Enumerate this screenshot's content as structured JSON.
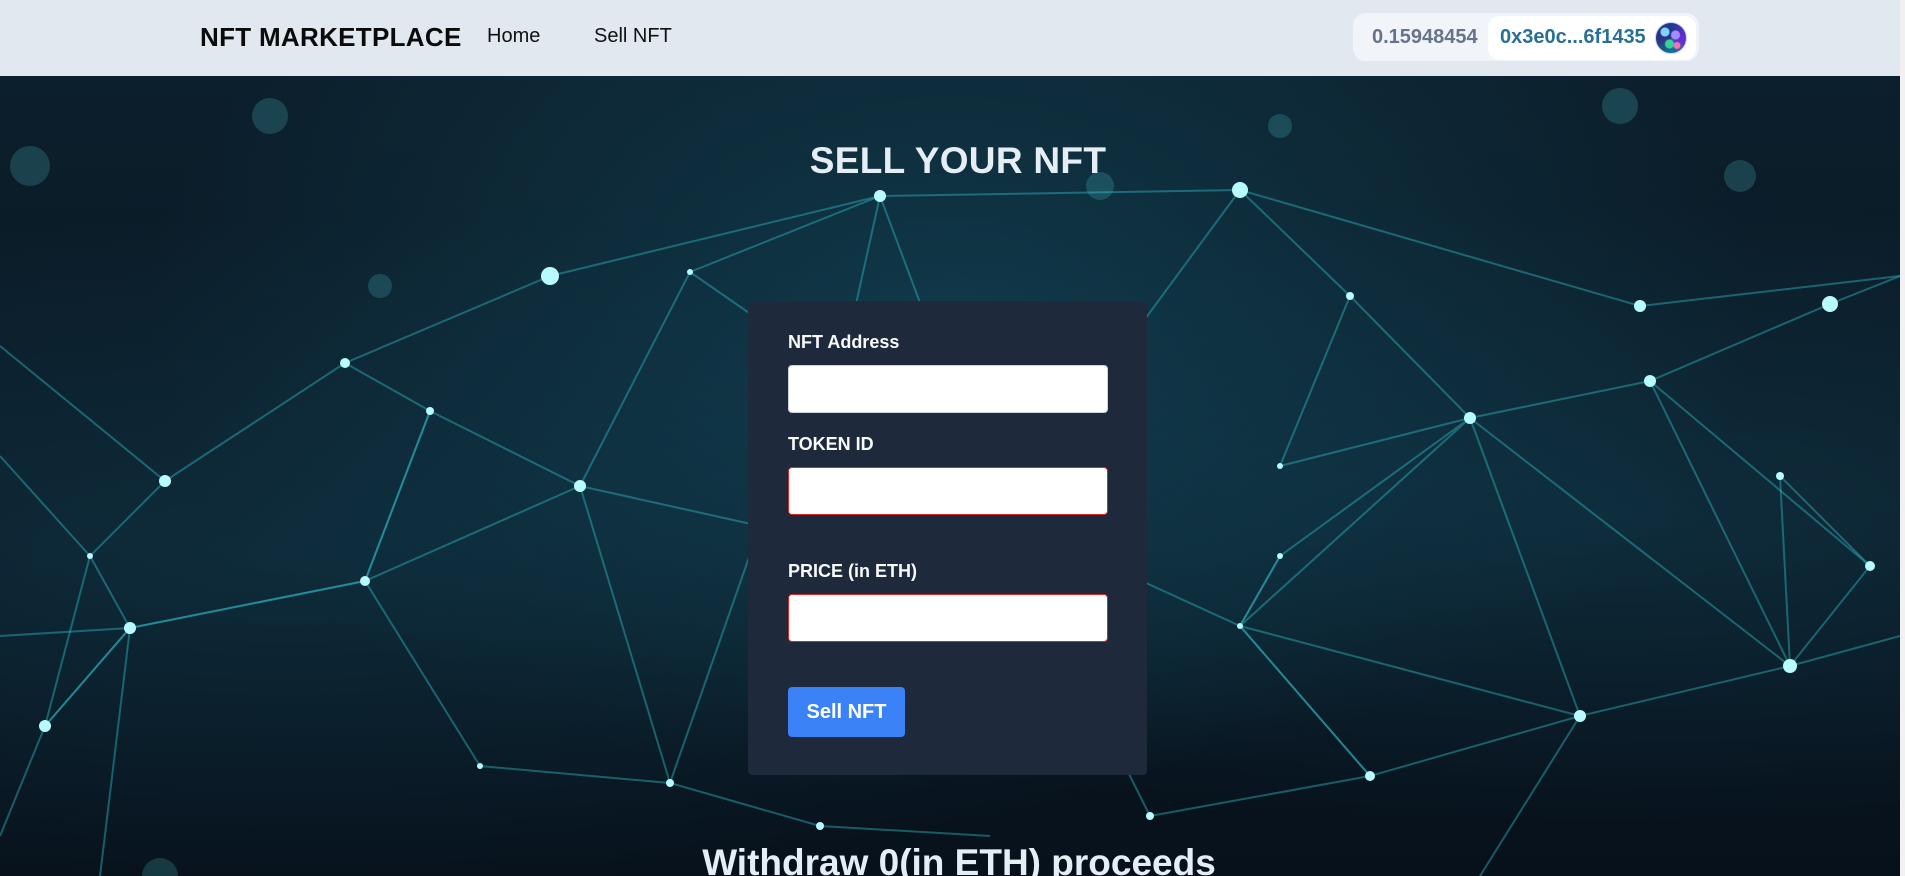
{
  "navbar": {
    "brand": "NFT MARKETPLACE",
    "links": [
      {
        "label": "Home"
      },
      {
        "label": "Sell NFT"
      }
    ],
    "wallet": {
      "balance": "0.15948454",
      "address": "0x3e0c...6f1435",
      "avatar_icon": "wallet-avatar-icon"
    }
  },
  "main": {
    "title": "SELL YOUR NFT",
    "form": {
      "fields": [
        {
          "label": "NFT Address",
          "value": "",
          "placeholder": ""
        },
        {
          "label": "TOKEN ID",
          "value": "",
          "placeholder": ""
        },
        {
          "label": "PRICE (in ETH)",
          "value": "",
          "placeholder": ""
        }
      ],
      "submit_label": "Sell NFT"
    },
    "withdraw_title": "Withdraw 0(in ETH) proceeds"
  },
  "colors": {
    "navbar_bg": "#e2e8f0",
    "card_bg": "#1e293b",
    "primary_button": "#3b82f6",
    "error_border": "#dc2626",
    "address_text": "#2a6f97"
  }
}
